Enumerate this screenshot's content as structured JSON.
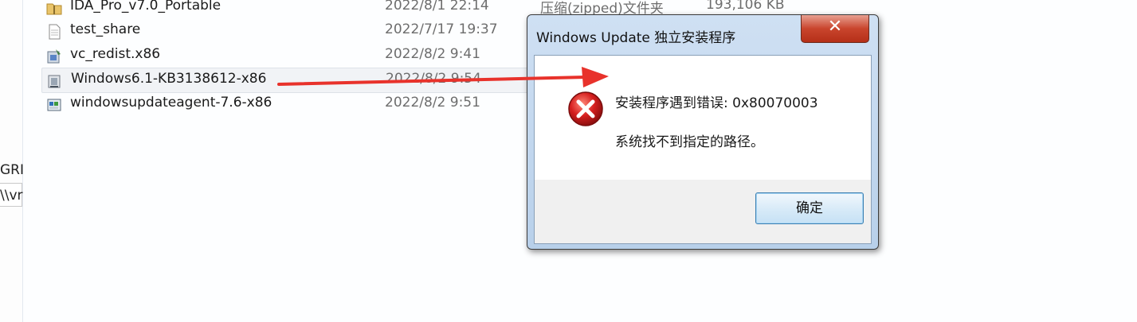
{
  "files": [
    {
      "name": "IDA_Pro_v7.0_Portable",
      "date": "2022/8/1 22:14",
      "type": "压缩(zipped)文件夹",
      "size": "193,106 KB",
      "icon": "zip-folder-icon"
    },
    {
      "name": "test_share",
      "date": "2022/7/17 19:37",
      "icon": "text-file-icon"
    },
    {
      "name": "vc_redist.x86",
      "date": "2022/8/2 9:41",
      "icon": "installer-icon"
    },
    {
      "name": "Windows6.1-KB3138612-x86",
      "date": "2022/8/2 9:54",
      "icon": "update-package-icon"
    },
    {
      "name": "windowsupdateagent-7.6-x86",
      "date": "2022/8/2 9:51",
      "icon": "update-agent-icon"
    }
  ],
  "left_fragments": [
    "GRI",
    "\\\\vr"
  ],
  "dialog": {
    "title": "Windows Update 独立安装程序",
    "close_label": "✕",
    "error_line": "安装程序遇到错误: 0x80070003",
    "detail_line": "系统找不到指定的路径。",
    "ok_label": "确定",
    "icon": "error-icon"
  },
  "colors": {
    "arrow": "#e8322b",
    "error": "#d61f1f"
  }
}
